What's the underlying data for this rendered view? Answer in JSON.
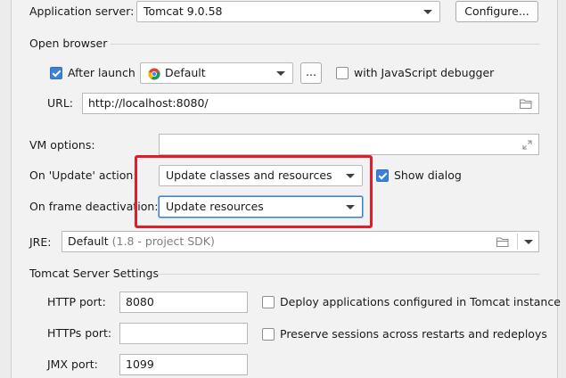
{
  "app_server": {
    "label": "Application server:",
    "value": "Tomcat 9.0.58",
    "configure_label": "Configure..."
  },
  "open_browser": {
    "section_title": "Open browser",
    "after_launch": {
      "label": "After launch",
      "checked": true
    },
    "browser_value": "Default",
    "ellipsis_label": "...",
    "js_debugger": {
      "label": "with JavaScript debugger",
      "checked": false
    },
    "url_label": "URL:",
    "url_value": "http://localhost:8080/"
  },
  "vm_options": {
    "label": "VM options:",
    "value": ""
  },
  "on_update": {
    "label": "On 'Update' action:",
    "value": "Update classes and resources",
    "show_dialog": {
      "label": "Show dialog",
      "checked": true
    }
  },
  "on_frame": {
    "label": "On frame deactivation:",
    "value": "Update resources"
  },
  "jre": {
    "label": "JRE:",
    "value": "Default",
    "hint": "(1.8 - project SDK)"
  },
  "tomcat_settings": {
    "section_title": "Tomcat Server Settings",
    "http_port": {
      "label": "HTTP port:",
      "value": "8080"
    },
    "https_port": {
      "label": "HTTPs port:",
      "value": ""
    },
    "jmx_port": {
      "label": "JMX port:",
      "value": "1099"
    },
    "deploy_apps": {
      "label": "Deploy applications configured in Tomcat instance",
      "checked": false
    },
    "preserve_sessions": {
      "label": "Preserve sessions across restarts and redeploys",
      "checked": false
    }
  },
  "colors": {
    "highlight": "#e21d27",
    "checkbox_on": "#3d80d8"
  }
}
